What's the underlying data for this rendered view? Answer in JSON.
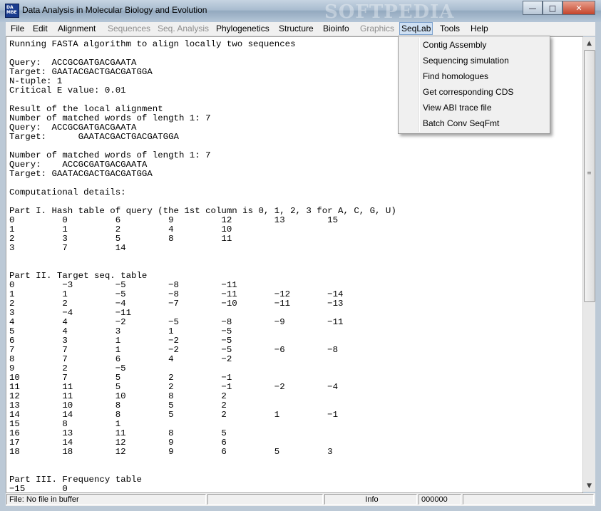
{
  "window": {
    "title": "Data Analysis in Molecular Biology and Evolution",
    "icon_text": [
      "DA",
      "MBE"
    ],
    "watermark": "SOFTPEDIA"
  },
  "caption_buttons": {
    "minimize": "—",
    "maximize": "□",
    "close": "✕"
  },
  "menus": [
    {
      "label": "File",
      "enabled": true
    },
    {
      "label": "Edit",
      "enabled": true
    },
    {
      "label": "Alignment",
      "enabled": true
    },
    {
      "label": "Sequences",
      "enabled": false
    },
    {
      "label": "Seq. Analysis",
      "enabled": false
    },
    {
      "label": "Phylogenetics",
      "enabled": true
    },
    {
      "label": "Structure",
      "enabled": true
    },
    {
      "label": "Bioinfo",
      "enabled": true
    },
    {
      "label": "Graphics",
      "enabled": false
    },
    {
      "label": "SeqLab",
      "enabled": true,
      "active": true
    },
    {
      "label": "Tools",
      "enabled": true
    },
    {
      "label": "Help",
      "enabled": true
    }
  ],
  "seqlab_menu": [
    "Contig Assembly",
    "Sequencing simulation",
    "Find homologues",
    "Get corresponding CDS",
    "View ABI trace file",
    "Batch Conv SeqFmt"
  ],
  "output_lines": [
    "Running FASTA algorithm to align locally two sequences",
    "",
    "Query:  ACCGCGATGACGAATA",
    "Target: GAATACGACTGACGATGGA",
    "N-tuple: 1",
    "Critical E value: 0.01",
    "",
    "Result of the local alignment",
    "Number of matched words of length 1: 7",
    "Query:  ACCGCGATGACGAATA",
    "Target:      GAATACGACTGACGATGGA",
    "",
    "Number of matched words of length 1: 7",
    "Query:    ACCGCGATGACGAATA",
    "Target: GAATACGACTGACGATGGA",
    "",
    "Computational details:",
    "",
    "Part I. Hash table of query (the 1st column is 0, 1, 2, 3 for A, C, G, U)",
    "0         0         6         9         12        13        15",
    "1         1         2         4         10",
    "2         3         5         8         11",
    "3         7         14",
    "",
    "",
    "Part II. Target seq. table",
    "0         −3        −5        −8        −11",
    "1         1         −5        −8        −11       −12       −14",
    "2         2         −4        −7        −10       −11       −13",
    "3         −4        −11",
    "4         4         −2        −5        −8        −9        −11",
    "5         4         3         1         −5",
    "6         3         1         −2        −5",
    "7         7         1         −2        −5        −6        −8",
    "8         7         6         4         −2",
    "9         2         −5",
    "10        7         5         2         −1",
    "11        11        5         2         −1        −2        −4",
    "12        11        10        8         2",
    "13        10        8         5         2",
    "14        14        8         5         2         1         −1",
    "15        8         1",
    "16        13        11        8         5",
    "17        14        12        9         6",
    "18        18        12        9         6         5         3",
    "",
    "",
    "Part III. Frequency table",
    "−15       0"
  ],
  "status": {
    "file": "File: No file in buffer",
    "panel2": "",
    "panel3": "",
    "info": "Info",
    "counter": "000000"
  }
}
